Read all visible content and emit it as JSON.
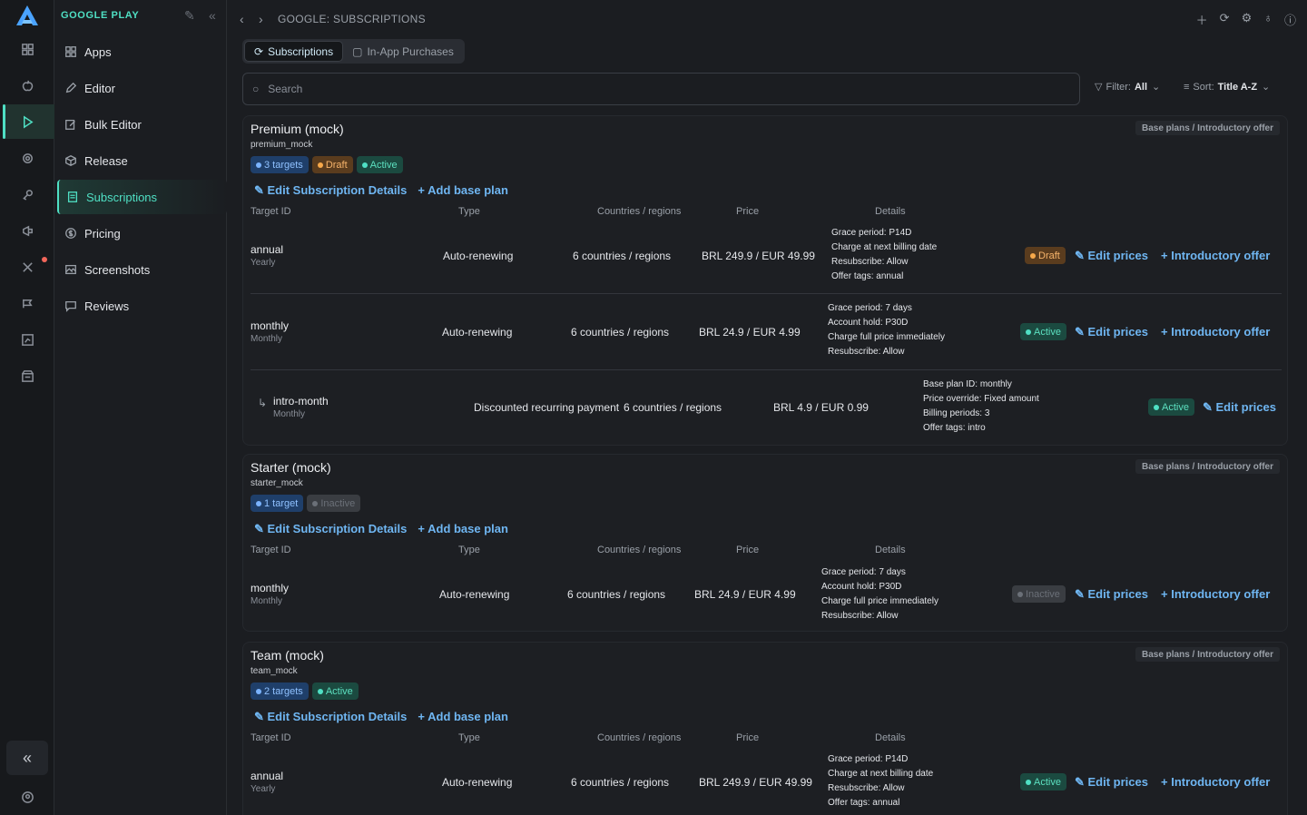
{
  "sidebar": {
    "header": "GOOGLE PLAY",
    "items": [
      {
        "label": "Apps",
        "icon": "apps-icon"
      },
      {
        "label": "Editor",
        "icon": "pencil-icon"
      },
      {
        "label": "Bulk Editor",
        "icon": "bulk-edit-icon"
      },
      {
        "label": "Release",
        "icon": "package-icon"
      },
      {
        "label": "Subscriptions",
        "icon": "document-icon"
      },
      {
        "label": "Pricing",
        "icon": "dollar-icon"
      },
      {
        "label": "Screenshots",
        "icon": "image-icon"
      },
      {
        "label": "Reviews",
        "icon": "chat-icon"
      }
    ]
  },
  "topbar": {
    "breadcrumb": "GOOGLE: SUBSCRIPTIONS"
  },
  "tabs": [
    {
      "label": "Subscriptions"
    },
    {
      "label": "In-App Purchases"
    }
  ],
  "search": {
    "placeholder": "Search"
  },
  "filter": {
    "label": "Filter:",
    "value": "All"
  },
  "sort": {
    "label": "Sort:",
    "value": "Title A-Z"
  },
  "common": {
    "base_plans_label": "Base plans / Introductory offer",
    "edit_details": "Edit Subscription Details",
    "add_base_plan": "Add base plan",
    "col_target": "Target ID",
    "col_type": "Type",
    "col_countries": "Countries / regions",
    "col_price": "Price",
    "col_details": "Details",
    "edit_prices": "Edit prices",
    "intro_offer": "Introductory offer"
  },
  "cards": [
    {
      "title": "Premium (mock)",
      "id": "premium_mock",
      "badges": [
        "3 targets",
        "Draft",
        "Active"
      ],
      "rows": [
        {
          "tid": "annual",
          "period": "Yearly",
          "type": "Auto-renewing",
          "countries": "6 countries / regions",
          "price": "BRL 249.9 / EUR 49.99",
          "details": [
            "Grace period: P14D",
            "Charge at next billing date",
            "Resubscribe: Allow",
            "Offer tags: annual"
          ],
          "status": "Draft"
        },
        {
          "tid": "monthly",
          "period": "Monthly",
          "type": "Auto-renewing",
          "countries": "6 countries / regions",
          "price": "BRL 24.9 / EUR 4.99",
          "details": [
            "Grace period: 7 days",
            "Account hold: P30D",
            "Charge full price immediately",
            "Resubscribe: Allow"
          ],
          "status": "Active"
        },
        {
          "tid": "intro-month",
          "period": "Monthly",
          "type": "Discounted recurring payment",
          "countries": "6 countries / regions",
          "price": "BRL 4.9 / EUR 0.99",
          "details": [
            "Base plan ID: monthly",
            "Price override: Fixed amount",
            "Billing periods: 3",
            "Offer tags: intro"
          ],
          "status": "Active"
        }
      ]
    },
    {
      "title": "Starter (mock)",
      "id": "starter_mock",
      "badges": [
        "1 target",
        "Inactive"
      ],
      "rows": [
        {
          "tid": "monthly",
          "period": "Monthly",
          "type": "Auto-renewing",
          "countries": "6 countries / regions",
          "price": "BRL 24.9 / EUR 4.99",
          "details": [
            "Grace period: 7 days",
            "Account hold: P30D",
            "Charge full price immediately",
            "Resubscribe: Allow"
          ],
          "status": "Inactive"
        }
      ]
    },
    {
      "title": "Team (mock)",
      "id": "team_mock",
      "badges": [
        "2 targets",
        "Active"
      ],
      "rows": [
        {
          "tid": "annual",
          "period": "Yearly",
          "type": "Auto-renewing",
          "countries": "6 countries / regions",
          "price": "BRL 249.9 / EUR 49.99",
          "details": [
            "Grace period: P14D",
            "Charge at next billing date",
            "Resubscribe: Allow",
            "Offer tags: annual"
          ],
          "status": "Active"
        }
      ]
    }
  ],
  "colors": {
    "accent": "#4fe0c4",
    "link": "#6fb6f2",
    "draft": "#f7a84a",
    "blue": "#7ab3ff"
  }
}
